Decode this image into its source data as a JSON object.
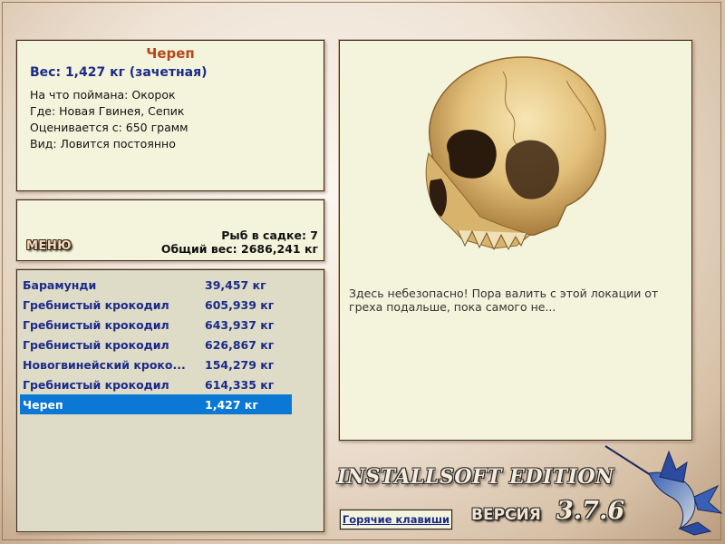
{
  "fish": {
    "name": "Череп",
    "weight_line": "Вес: 1,427 кг (зачетная)",
    "bait": "На что поймана: Окорок",
    "location": "Где: Новая Гвинея, Сепик",
    "min_weight": "Оценивается с: 650 грамм",
    "type": "Вид: Ловится постоянно",
    "description": "Здесь небезопасно! Пора валить с этой локации от греха подальше, пока самого не..."
  },
  "menu": {
    "label": "МЕНЮ",
    "fish_count": "Рыб в садке: 7",
    "total_weight": "Общий вес: 2686,241 кг"
  },
  "catch_list": [
    {
      "name": "Барамунди",
      "weight": "39,457 кг"
    },
    {
      "name": "Гребнистый крокодил",
      "weight": "605,939 кг"
    },
    {
      "name": "Гребнистый крокодил",
      "weight": "643,937 кг"
    },
    {
      "name": "Гребнистый крокодил",
      "weight": "626,867 кг"
    },
    {
      "name": "Новогвинейский кроко...",
      "weight": "154,279 кг"
    },
    {
      "name": "Гребнистый крокодил",
      "weight": "614,335 кг"
    },
    {
      "name": "Череп",
      "weight": "1,427 кг",
      "selected": true
    }
  ],
  "footer": {
    "hotkeys": "Горячие клавиши",
    "brand": "INSTALLSOFT EDITION",
    "version_label": "ВЕРСИЯ",
    "version": "3.7.6"
  },
  "colors": {
    "panel_bg": "#f4f4dc",
    "list_bg": "#dedcc6",
    "title_color": "#b5471a",
    "text_blue": "#1c2a8a",
    "selection": "#0a78d4"
  },
  "icons": {
    "catch_image": "skull-image",
    "brand_logo": "marlin-icon"
  }
}
